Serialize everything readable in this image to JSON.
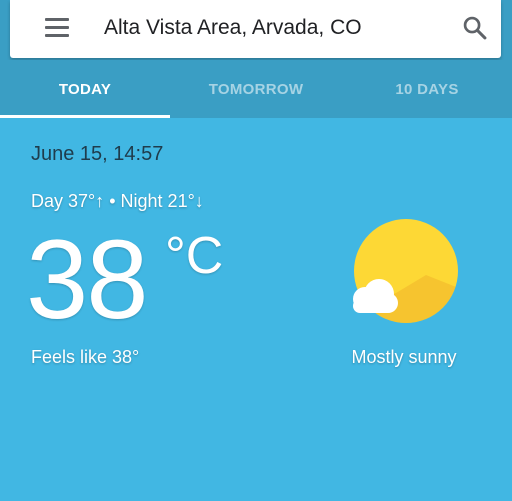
{
  "search": {
    "location": "Alta Vista Area, Arvada, CO"
  },
  "tabs": [
    {
      "label": "TODAY",
      "active": true
    },
    {
      "label": "TOMORROW",
      "active": false
    },
    {
      "label": "10 DAYS",
      "active": false
    }
  ],
  "weather": {
    "datetime": "June 15, 14:57",
    "day_night": "Day 37°↑ • Night 21°↓",
    "temperature": "38",
    "unit": "°C",
    "feels_like": "Feels like 38°",
    "condition": "Mostly sunny",
    "icon": "sun-cloud-icon"
  },
  "colors": {
    "background": "#41b7e3",
    "tab_bar": "#3a9ec4",
    "sun": "#fdd835"
  }
}
